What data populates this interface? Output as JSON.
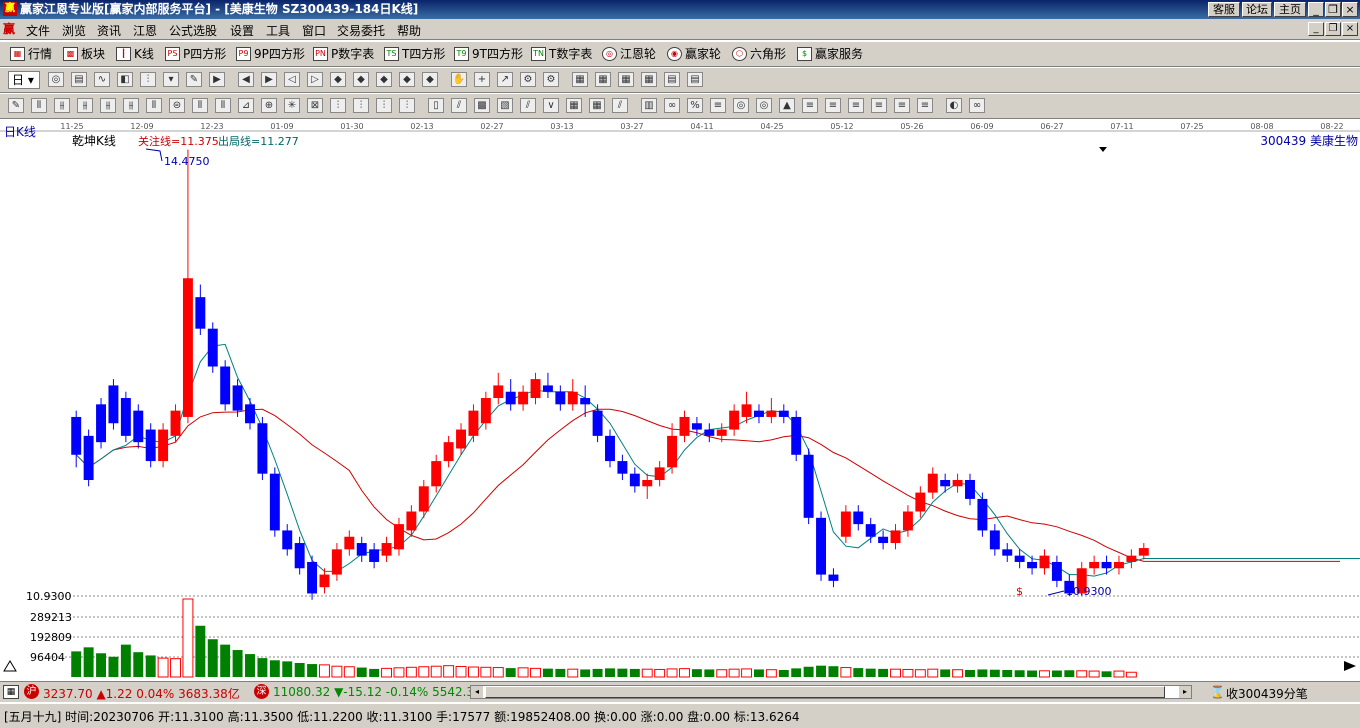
{
  "window": {
    "title": "赢家江恩专业版[赢家内部服务平台] - [美康生物   SZ300439-184日K线]",
    "btn_service": "客服",
    "btn_forum": "论坛",
    "btn_home": "主页"
  },
  "menu": [
    "文件",
    "浏览",
    "资讯",
    "江恩",
    "公式选股",
    "设置",
    "工具",
    "窗口",
    "交易委托",
    "帮助"
  ],
  "toolbar1": [
    {
      "label": "行情",
      "icon": "grid-icon"
    },
    {
      "label": "板块",
      "icon": "block-icon"
    },
    {
      "label": "K线",
      "icon": "kline-icon"
    },
    {
      "label": "P四方形",
      "icon": "ps-icon"
    },
    {
      "label": "9P四方形",
      "icon": "p9-icon"
    },
    {
      "label": "P数字表",
      "icon": "pn-icon"
    },
    {
      "label": "T四方形",
      "icon": "ts-icon"
    },
    {
      "label": "9T四方形",
      "icon": "t9-icon"
    },
    {
      "label": "T数字表",
      "icon": "tn-icon"
    },
    {
      "label": "江恩轮",
      "icon": "gann-wheel-icon"
    },
    {
      "label": "赢家轮",
      "icon": "winner-wheel-icon"
    },
    {
      "label": "六角形",
      "icon": "hexagon-icon"
    },
    {
      "label": "赢家服务",
      "icon": "service-icon"
    }
  ],
  "period_label": "日",
  "chart_data": {
    "type": "candlestick",
    "panel_label": "日K线",
    "indicator_name": "乾坤K线",
    "watch_line": "关注线=11.375",
    "exit_line": "出局线=11.277",
    "stock_label": "300439  美康生物",
    "high_label": "14.4750",
    "low_label": "10.9300",
    "axis_low": "10.9300",
    "dollar_mark": "$",
    "x_ticks": [
      "11-25",
      "12-09",
      "12-23",
      "01-09",
      "01-30",
      "02-13",
      "02-27",
      "03-13",
      "03-27",
      "04-11",
      "04-25",
      "05-12",
      "05-26",
      "06-09",
      "06-27",
      "07-11",
      "07-25",
      "08-08",
      "08-22"
    ],
    "volume_ticks": [
      "289213",
      "192809",
      "96404"
    ],
    "ylim": [
      10.93,
      14.475
    ],
    "candles": [
      [
        12.35,
        12.05,
        12.4,
        11.95
      ],
      [
        12.2,
        11.85,
        12.25,
        11.8
      ],
      [
        12.45,
        12.15,
        12.5,
        12.1
      ],
      [
        12.6,
        12.3,
        12.65,
        12.25
      ],
      [
        12.5,
        12.2,
        12.55,
        12.15
      ],
      [
        12.4,
        12.15,
        12.45,
        12.1
      ],
      [
        12.25,
        12.0,
        12.3,
        11.95
      ],
      [
        12.0,
        12.25,
        12.3,
        11.95
      ],
      [
        12.2,
        12.4,
        12.45,
        12.15
      ],
      [
        12.35,
        13.45,
        14.47,
        12.3
      ],
      [
        13.3,
        13.05,
        13.4,
        13.0
      ],
      [
        13.05,
        12.75,
        13.1,
        12.7
      ],
      [
        12.75,
        12.45,
        12.8,
        12.4
      ],
      [
        12.6,
        12.4,
        12.65,
        12.35
      ],
      [
        12.45,
        12.3,
        12.5,
        12.25
      ],
      [
        12.3,
        11.9,
        12.35,
        11.85
      ],
      [
        11.9,
        11.45,
        11.95,
        11.4
      ],
      [
        11.45,
        11.3,
        11.5,
        11.25
      ],
      [
        11.35,
        11.15,
        11.4,
        11.1
      ],
      [
        11.2,
        10.95,
        11.25,
        10.9
      ],
      [
        11.0,
        11.1,
        11.15,
        10.95
      ],
      [
        11.1,
        11.3,
        11.35,
        11.05
      ],
      [
        11.3,
        11.4,
        11.45,
        11.25
      ],
      [
        11.35,
        11.25,
        11.4,
        11.2
      ],
      [
        11.3,
        11.2,
        11.35,
        11.15
      ],
      [
        11.25,
        11.35,
        11.4,
        11.2
      ],
      [
        11.3,
        11.5,
        11.55,
        11.25
      ],
      [
        11.45,
        11.6,
        11.65,
        11.4
      ],
      [
        11.6,
        11.8,
        11.85,
        11.55
      ],
      [
        11.8,
        12.0,
        12.05,
        11.75
      ],
      [
        12.0,
        12.15,
        12.2,
        11.95
      ],
      [
        12.1,
        12.25,
        12.3,
        12.05
      ],
      [
        12.2,
        12.4,
        12.45,
        12.15
      ],
      [
        12.3,
        12.5,
        12.55,
        12.25
      ],
      [
        12.5,
        12.6,
        12.7,
        12.45
      ],
      [
        12.55,
        12.45,
        12.65,
        12.4
      ],
      [
        12.45,
        12.55,
        12.6,
        12.4
      ],
      [
        12.5,
        12.65,
        12.7,
        12.45
      ],
      [
        12.6,
        12.55,
        12.7,
        12.5
      ],
      [
        12.55,
        12.45,
        12.6,
        12.4
      ],
      [
        12.45,
        12.55,
        12.65,
        12.4
      ],
      [
        12.5,
        12.45,
        12.6,
        12.35
      ],
      [
        12.4,
        12.2,
        12.45,
        12.15
      ],
      [
        12.2,
        12.0,
        12.25,
        11.95
      ],
      [
        12.0,
        11.9,
        12.05,
        11.85
      ],
      [
        11.9,
        11.8,
        11.95,
        11.75
      ],
      [
        11.8,
        11.85,
        11.9,
        11.7
      ],
      [
        11.85,
        11.95,
        12.0,
        11.8
      ],
      [
        11.95,
        12.2,
        12.3,
        11.9
      ],
      [
        12.2,
        12.35,
        12.4,
        12.15
      ],
      [
        12.3,
        12.25,
        12.35,
        12.2
      ],
      [
        12.25,
        12.2,
        12.3,
        12.15
      ],
      [
        12.2,
        12.25,
        12.3,
        12.15
      ],
      [
        12.25,
        12.4,
        12.45,
        12.2
      ],
      [
        12.35,
        12.45,
        12.55,
        12.3
      ],
      [
        12.4,
        12.35,
        12.45,
        12.3
      ],
      [
        12.35,
        12.4,
        12.5,
        12.3
      ],
      [
        12.4,
        12.35,
        12.45,
        12.3
      ],
      [
        12.35,
        12.05,
        12.4,
        12.0
      ],
      [
        12.05,
        11.55,
        12.1,
        11.5
      ],
      [
        11.55,
        11.1,
        11.6,
        11.05
      ],
      [
        11.1,
        11.05,
        11.15,
        11.0
      ],
      [
        11.4,
        11.6,
        11.65,
        11.35
      ],
      [
        11.6,
        11.5,
        11.65,
        11.45
      ],
      [
        11.5,
        11.4,
        11.55,
        11.35
      ],
      [
        11.4,
        11.35,
        11.45,
        11.3
      ],
      [
        11.35,
        11.45,
        11.5,
        11.3
      ],
      [
        11.45,
        11.6,
        11.65,
        11.4
      ],
      [
        11.6,
        11.75,
        11.8,
        11.55
      ],
      [
        11.75,
        11.9,
        11.95,
        11.7
      ],
      [
        11.85,
        11.8,
        11.9,
        11.75
      ],
      [
        11.8,
        11.85,
        11.9,
        11.75
      ],
      [
        11.85,
        11.7,
        11.9,
        11.65
      ],
      [
        11.7,
        11.45,
        11.75,
        11.4
      ],
      [
        11.45,
        11.3,
        11.5,
        11.25
      ],
      [
        11.3,
        11.25,
        11.35,
        11.2
      ],
      [
        11.25,
        11.2,
        11.3,
        11.15
      ],
      [
        11.2,
        11.15,
        11.25,
        11.1
      ],
      [
        11.15,
        11.25,
        11.3,
        11.1
      ],
      [
        11.2,
        11.05,
        11.25,
        11.0
      ],
      [
        11.05,
        10.95,
        11.1,
        10.93
      ],
      [
        10.95,
        11.15,
        11.2,
        10.93
      ],
      [
        11.15,
        11.2,
        11.25,
        11.1
      ],
      [
        11.2,
        11.15,
        11.25,
        11.1
      ],
      [
        11.15,
        11.2,
        11.25,
        11.1
      ],
      [
        11.2,
        11.25,
        11.3,
        11.15
      ],
      [
        11.25,
        11.31,
        11.35,
        11.22
      ]
    ],
    "volume": [
      95000,
      110000,
      88000,
      75000,
      120000,
      92000,
      80000,
      70000,
      68000,
      289213,
      190000,
      140000,
      120000,
      100000,
      85000,
      70000,
      62000,
      58000,
      52000,
      48000,
      45000,
      40000,
      38000,
      35000,
      30000,
      32000,
      34000,
      36000,
      38000,
      40000,
      42000,
      39000,
      37000,
      36000,
      35000,
      33000,
      34000,
      32000,
      31000,
      30000,
      29000,
      28000,
      30000,
      32000,
      31000,
      30000,
      29000,
      28000,
      30000,
      31000,
      29000,
      28000,
      27000,
      29000,
      30000,
      28000,
      27000,
      26000,
      32000,
      38000,
      42000,
      40000,
      35000,
      33000,
      31000,
      30000,
      29000,
      28000,
      27000,
      29000,
      28000,
      27000,
      26000,
      28000,
      27000,
      26000,
      25000,
      24000,
      23000,
      24000,
      25000,
      23000,
      22000,
      21000,
      22000,
      17577
    ]
  },
  "status_top": {
    "sh_badge": "沪",
    "sh_text": "3237.70 ▲1.22 0.04% 3683.38亿",
    "sz_badge": "深",
    "sz_text": "11080.32 ▼-15.12 -0.14% 5542.3",
    "right": "收300439分笔"
  },
  "status_bottom": "[五月十九] 时间:20230706 开:11.3100 高:11.3500 低:11.2200 收:11.3100 手:17577 额:19852408.00 换:0.00 涨:0.00 盘:0.00 标:13.6264",
  "colors": {
    "up": "#ff0000",
    "down": "#0000ff",
    "doji": "#7b1a7b",
    "ma_red": "#d00000",
    "ma_teal": "#008080",
    "vol_green": "#008000",
    "vol_red": "#ff0000"
  }
}
